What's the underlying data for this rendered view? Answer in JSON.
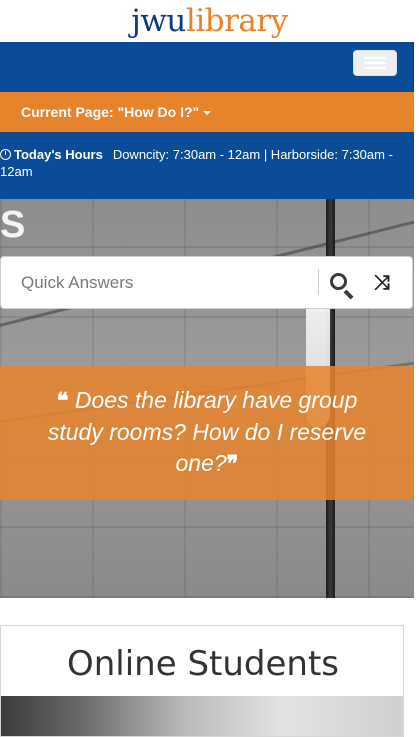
{
  "header": {
    "logo_jwu": "jwu",
    "logo_library": "library"
  },
  "nav": {
    "menu_toggle_icon": "hamburger-icon"
  },
  "current_page": {
    "label": "Current Page: \"How Do I?\""
  },
  "hours": {
    "icon": "clock-icon",
    "label": "Today's Hours",
    "text": "Downcity: 7:30am - 12am | Harborside: 7:30am - 12am"
  },
  "search": {
    "placeholder": "Quick Answers",
    "search_icon": "search-icon",
    "shuffle_icon": "shuffle-icon"
  },
  "quote": {
    "open": "❝",
    "text": "Does the library have group study rooms? How do I reserve one?",
    "close": "❞"
  },
  "card": {
    "title": "Online Students"
  },
  "colors": {
    "brand_blue": "#0a4c97",
    "brand_orange": "#e6832b"
  }
}
